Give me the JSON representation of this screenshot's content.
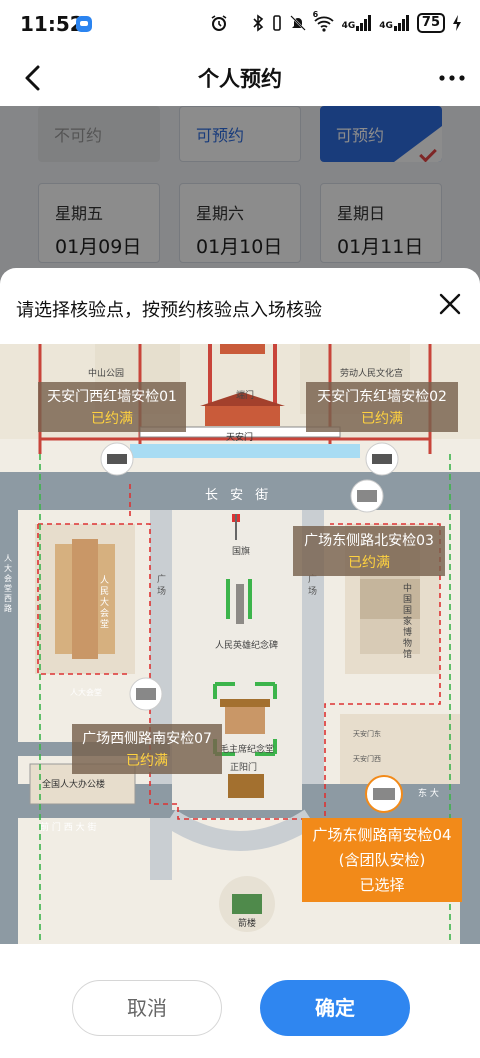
{
  "status_bar": {
    "time": "11:52",
    "battery": "75",
    "network_1": "4G",
    "network_2": "4G",
    "wifi_badge": "6"
  },
  "nav": {
    "title": "个人预约"
  },
  "background": {
    "slots": [
      {
        "label": "不可约",
        "state": "disabled"
      },
      {
        "label": "可预约",
        "state": "available"
      },
      {
        "label": "可预约",
        "state": "selected"
      }
    ],
    "days": [
      {
        "weekday": "星期五",
        "date": "01月09日"
      },
      {
        "weekday": "星期六",
        "date": "01月10日"
      },
      {
        "weekday": "星期日",
        "date": "01月11日"
      }
    ]
  },
  "sheet": {
    "title": "请选择核验点，按预约核验点入场核验"
  },
  "map": {
    "places": {
      "zhongshan_park": "中山公园",
      "culture_palace": "劳动人民文化宫",
      "duanmen": "端门",
      "tiananmen": "天安门",
      "changan_street": "长 安 街",
      "flag": "国旗",
      "great_hall": "人民大会堂",
      "museum": "中国国家博物馆",
      "monument": "人民英雄纪念碑",
      "mausoleum": "毛主席纪念堂",
      "zhengyangmen": "正阳门",
      "npc_office": "全国人大办公楼",
      "qianmen_west": "前 门 西 大 街",
      "dongda": "东 大",
      "jianlou": "箭楼",
      "guangchang_west": "广 场",
      "guangchang_east": "广 场",
      "renda_west": "人大会堂西路",
      "renda_east": "人大会堂",
      "tiananmen_east_station": "天安门东",
      "tiananmen_west_station": "天安门西"
    },
    "checkpoints": [
      {
        "name": "天安门西红墙安检01",
        "status": "已约满"
      },
      {
        "name": "天安门东红墙安检02",
        "status": "已约满"
      },
      {
        "name": "广场东侧路北安检03",
        "status": "已约满"
      },
      {
        "name": "广场西侧路南安检07",
        "status": "已约满"
      },
      {
        "name": "广场东侧路南安检04",
        "sub": "(含团队安检)",
        "status": "已选择"
      }
    ],
    "colors": {
      "road": "#8d9aa3",
      "wall_red": "#c8443a",
      "walk_green": "#3cb44b",
      "water": "#a8dcf3",
      "selected": "#f28a19",
      "full_text": "#ffd23f"
    }
  },
  "actions": {
    "cancel": "取消",
    "confirm": "确定"
  }
}
